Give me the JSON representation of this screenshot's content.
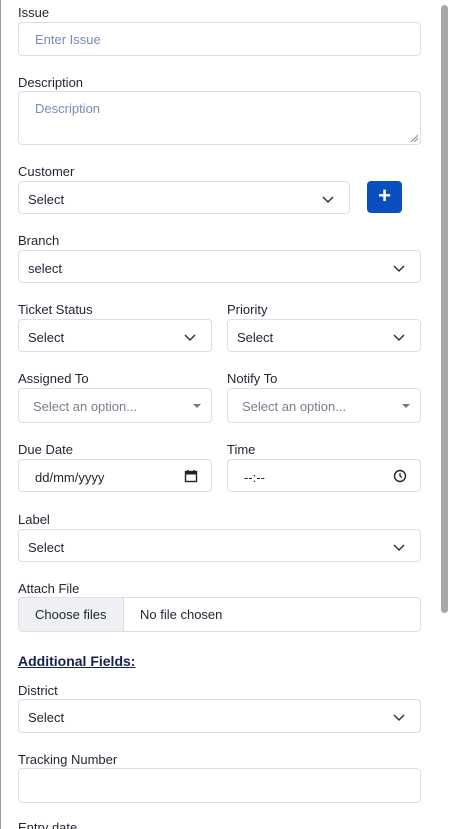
{
  "issue": {
    "label": "Issue",
    "placeholder": "Enter Issue"
  },
  "description": {
    "label": "Description",
    "placeholder": "Description"
  },
  "customer": {
    "label": "Customer",
    "value": "Select",
    "add_icon": "plus-icon"
  },
  "branch": {
    "label": "Branch",
    "value": "select"
  },
  "ticket_status": {
    "label": "Ticket Status",
    "value": "Select"
  },
  "priority": {
    "label": "Priority",
    "value": "Select"
  },
  "assigned_to": {
    "label": "Assigned To",
    "placeholder": "Select an option..."
  },
  "notify_to": {
    "label": "Notify To",
    "placeholder": "Select an option..."
  },
  "due_date": {
    "label": "Due Date",
    "placeholder": "dd/mm/yyyy",
    "icon": "calendar-icon"
  },
  "time": {
    "label": "Time",
    "placeholder": "--:--",
    "icon": "clock-icon"
  },
  "label_field": {
    "label": "Label",
    "value": "Select"
  },
  "attach_file": {
    "label": "Attach File",
    "button": "Choose files",
    "status": "No file chosen"
  },
  "additional_fields": {
    "title": "Additional Fields:"
  },
  "district": {
    "label": "District",
    "value": "Select"
  },
  "tracking_number": {
    "label": "Tracking Number",
    "value": ""
  },
  "entry_date": {
    "label": "Entry date"
  },
  "colors": {
    "accent": "#0b4fbf",
    "placeholder": "#7b88b8",
    "border": "#dcdfe6",
    "heading": "#14224d"
  }
}
